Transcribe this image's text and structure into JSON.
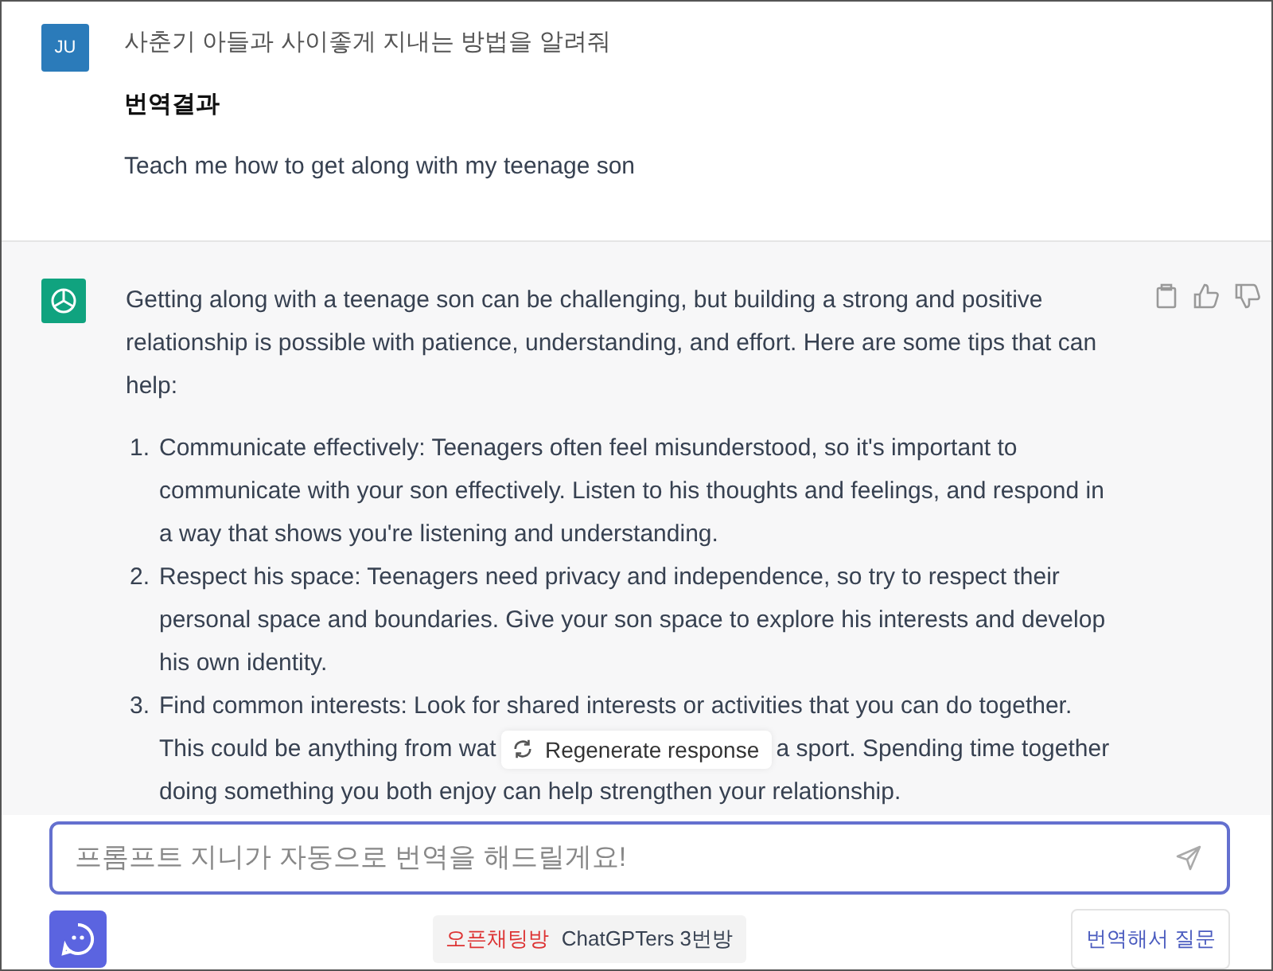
{
  "user_message": {
    "avatar": "JU",
    "text": "사춘기 아들과 사이좋게 지내는 방법을 알려줘",
    "translation_heading": "번역결과",
    "translation": "Teach me how to get along with my teenage son"
  },
  "assistant_message": {
    "intro": "Getting along with a teenage son can be challenging, but building a strong and positive relationship is possible with patience, understanding, and effort. Here are some tips that can help:",
    "tips": [
      {
        "number": "1.",
        "text": "Communicate effectively: Teenagers often feel misunderstood, so it's important to communicate with your son effectively. Listen to his thoughts and feelings, and respond in a way that shows you're listening and understanding."
      },
      {
        "number": "2.",
        "text": "Respect his space: Teenagers need privacy and independence, so try to respect their personal space and boundaries. Give your son space to explore his interests and develop his own identity."
      },
      {
        "number": "3.",
        "text": "Find common interests: Look for shared interests or activities that you can do together.",
        "before_cover": "This could be anything from wat",
        "after_cover": "a sport. Spending time together",
        "last_line": "doing something you both enjoy can help strengthen your relationship."
      }
    ]
  },
  "regenerate_button": {
    "label": "Regenerate response"
  },
  "prompt_input": {
    "placeholder": "프롬프트 지니가 자동으로 번역을 해드릴게요!"
  },
  "footer": {
    "chat_label": "오픈채팅방",
    "chat_room": "ChatGPTers 3번방",
    "translate_button": "번역해서 질문"
  }
}
